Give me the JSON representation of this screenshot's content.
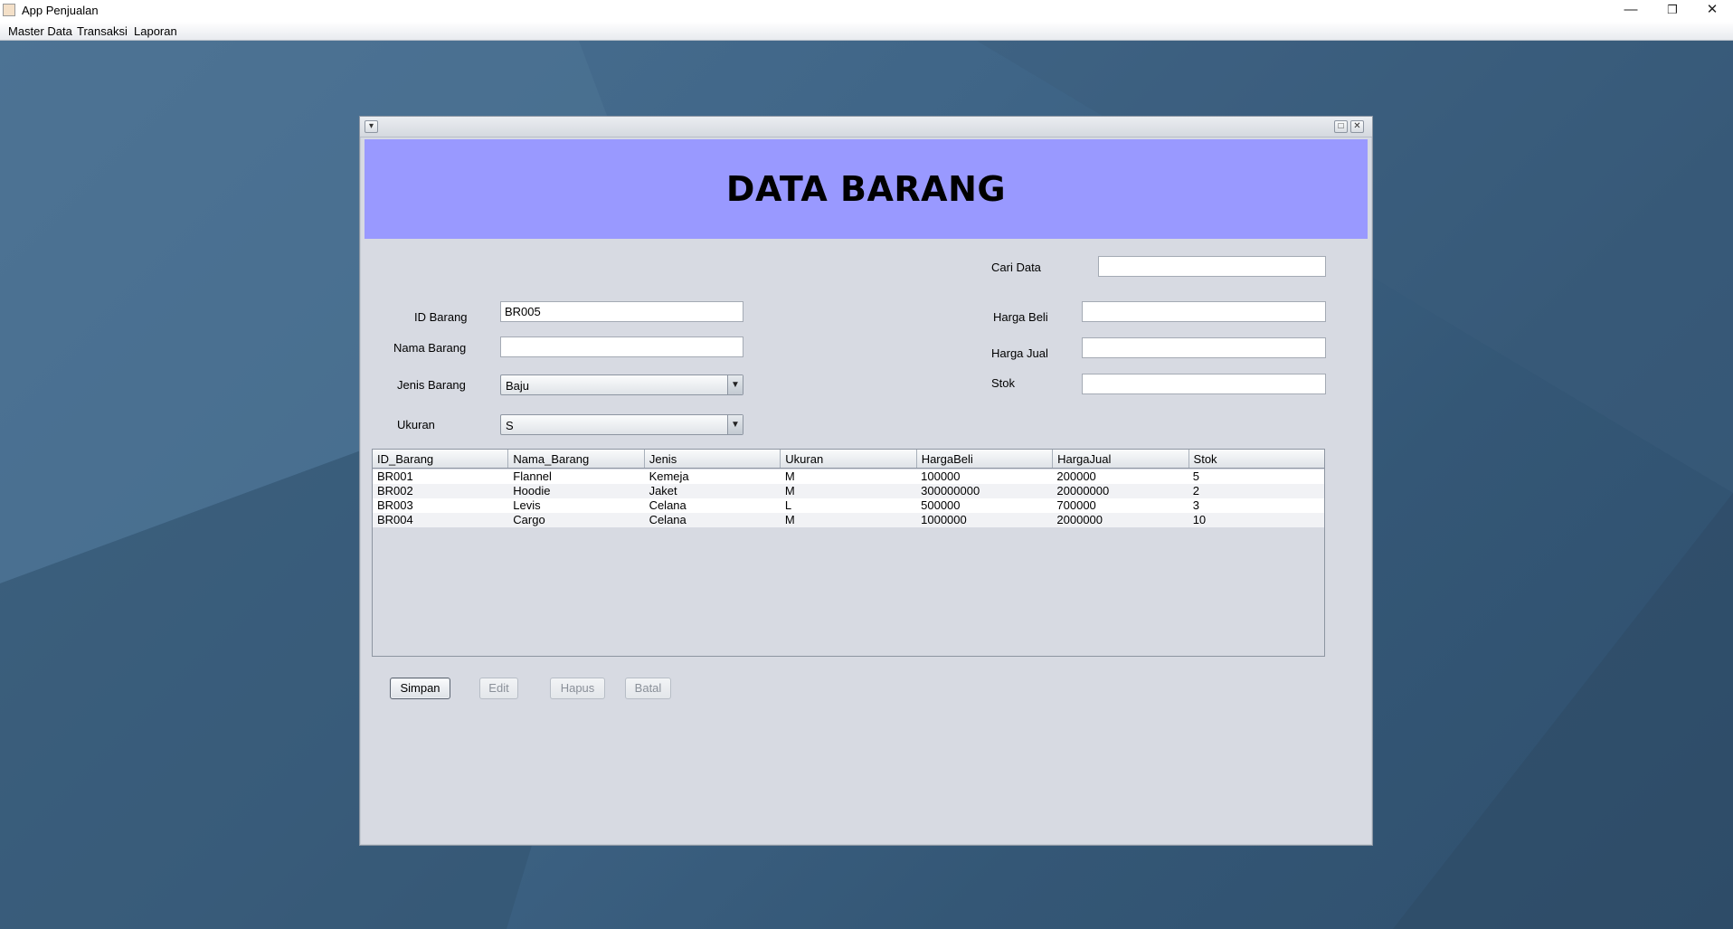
{
  "window": {
    "title": "App Penjualan",
    "minimize_glyph": "—",
    "maximize_glyph": "❐",
    "close_glyph": "✕"
  },
  "menubar": {
    "items": [
      "Master Data",
      "Transaksi",
      "Laporan"
    ]
  },
  "frame": {
    "system_menu_glyph": "▾",
    "maximize_glyph": "□",
    "close_glyph": "✕",
    "banner_title": "DATA BARANG"
  },
  "search": {
    "label": "Cari Data",
    "value": ""
  },
  "form": {
    "id_barang": {
      "label": "ID Barang",
      "value": "BR005"
    },
    "nama_barang": {
      "label": "Nama Barang",
      "value": ""
    },
    "jenis_barang": {
      "label": "Jenis Barang",
      "selected": "Baju"
    },
    "ukuran": {
      "label": "Ukuran",
      "selected": "S"
    },
    "harga_beli": {
      "label": "Harga Beli",
      "value": ""
    },
    "harga_jual": {
      "label": "Harga Jual",
      "value": ""
    },
    "stok": {
      "label": "Stok",
      "value": ""
    },
    "combo_arrow_glyph": "▼"
  },
  "table": {
    "columns": [
      "ID_Barang",
      "Nama_Barang",
      "Jenis",
      "Ukuran",
      "HargaBeli",
      "HargaJual",
      "Stok"
    ],
    "rows": [
      [
        "BR001",
        "Flannel",
        "Kemeja",
        "M",
        "100000",
        "200000",
        "5"
      ],
      [
        "BR002",
        "Hoodie",
        "Jaket",
        "M",
        "300000000",
        "20000000",
        "2"
      ],
      [
        "BR003",
        "Levis",
        "Celana",
        "L",
        "500000",
        "700000",
        "3"
      ],
      [
        "BR004",
        "Cargo",
        "Celana",
        "M",
        "1000000",
        "2000000",
        "10"
      ]
    ]
  },
  "buttons": {
    "simpan": "Simpan",
    "edit": "Edit",
    "hapus": "Hapus",
    "batal": "Batal"
  }
}
